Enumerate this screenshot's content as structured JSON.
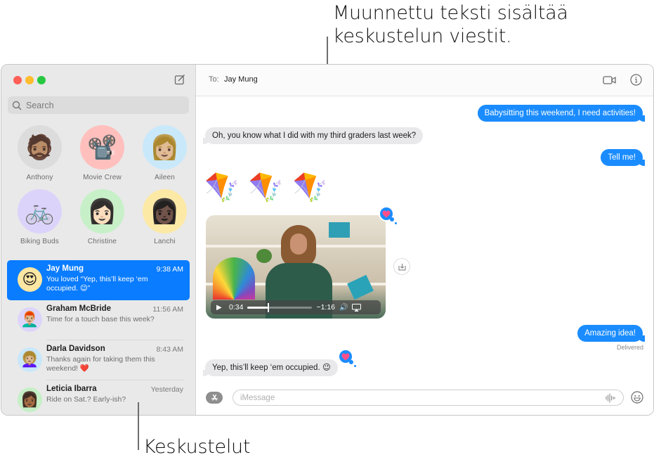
{
  "annotations": {
    "top_line1": "Muunnettu teksti sisältää",
    "top_line2": "keskustelun viestit.",
    "bottom": "Keskustelut"
  },
  "sidebar": {
    "search_placeholder": "Search",
    "pinned": [
      {
        "name": "Anthony",
        "emoji": "🧔🏽",
        "bg": "#dcdcdc"
      },
      {
        "name": "Movie Crew",
        "emoji": "📽️",
        "bg": "#ffc0bd"
      },
      {
        "name": "Aileen",
        "emoji": "👩🏼",
        "bg": "#c9e9fb"
      },
      {
        "name": "Biking Buds",
        "emoji": "🚲",
        "bg": "#dcd3fb"
      },
      {
        "name": "Christine",
        "emoji": "👩🏻",
        "bg": "#c7f0c8"
      },
      {
        "name": "Lanchi",
        "emoji": "👩🏿",
        "bg": "#fde9a6"
      }
    ],
    "conversations": [
      {
        "name": "Jay Mung",
        "time": "9:38 AM",
        "preview": "You loved “Yep, this’ll keep ‘em occupied. 😉”",
        "emoji": "😍",
        "bg": "#fde7a3",
        "selected": true
      },
      {
        "name": "Graham McBride",
        "time": "11:56 AM",
        "preview": "Time for a touch base this week?",
        "emoji": "👨🏼‍🦰",
        "bg": "#ddd4fa",
        "selected": false
      },
      {
        "name": "Darla Davidson",
        "time": "8:43 AM",
        "preview": "Thanks again for taking them this weekend! ❤️",
        "emoji": "👩🏼‍🦱",
        "bg": "#c9e7fb",
        "selected": false
      },
      {
        "name": "Leticia Ibarra",
        "time": "Yesterday",
        "preview": "Ride on Sat.? Early-ish?",
        "emoji": "👩🏾",
        "bg": "#c5efc6",
        "selected": false
      }
    ]
  },
  "header": {
    "to_label": "To:",
    "recipient": "Jay Mung"
  },
  "messages": {
    "m1": "Babysitting this weekend, I need activities!",
    "m2": "Oh, you know what I did with my third graders last week?",
    "m3": "Tell me!",
    "kites": [
      "🪁",
      "🪁",
      "🪁"
    ],
    "video": {
      "elapsed": "0:34",
      "remaining": "−1:16",
      "progress": 0.31
    },
    "m5": "Amazing idea!",
    "delivered": "Delivered",
    "m6": "Yep, this’ll keep ‘em occupied. 😉",
    "tapback": "♥"
  },
  "composer": {
    "placeholder": "iMessage"
  },
  "colors": {
    "accent": "#1a8cff",
    "selection": "#0a7cff",
    "heart": "#ff4f8b"
  }
}
